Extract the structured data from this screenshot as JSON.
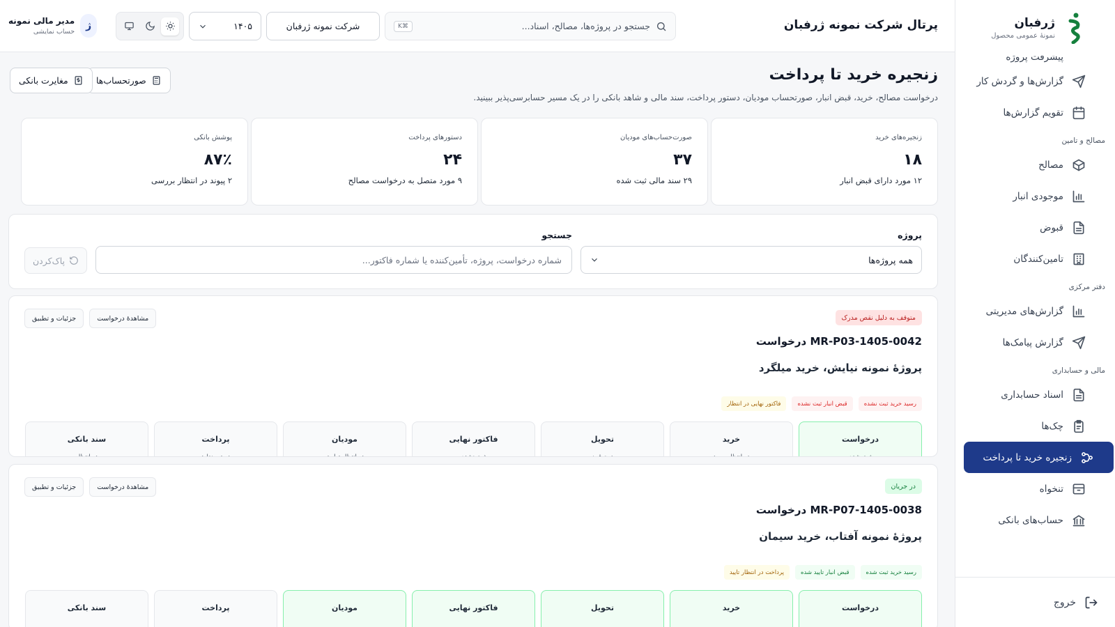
{
  "brand": {
    "name": "ژرفبان",
    "subtitle": "نمونهٔ عمومی محصول",
    "color": "#15803d"
  },
  "sidebar": {
    "partial_item": "پیشرفت پروژه",
    "top_items": [
      {
        "label": "گزارش‌ها و گردش کار",
        "icon": "send-icon"
      },
      {
        "label": "تقویم گزارش‌ها",
        "icon": "calendar-icon"
      }
    ],
    "sections": [
      {
        "title": "مصالح و تامین",
        "items": [
          {
            "label": "مصالح",
            "icon": "box-icon"
          },
          {
            "label": "موجودی انبار",
            "icon": "bar-chart-icon"
          },
          {
            "label": "قبوض",
            "icon": "document-icon"
          },
          {
            "label": "تامین‌کنندگان",
            "icon": "building-icon"
          }
        ]
      },
      {
        "title": "دفتر مرکزی",
        "items": [
          {
            "label": "گزارش‌های مدیریتی",
            "icon": "bar-chart-icon"
          },
          {
            "label": "گزارش پیامک‌ها",
            "icon": "send-icon"
          }
        ]
      },
      {
        "title": "مالی و حسابداری",
        "items": [
          {
            "label": "اسناد حسابداری",
            "icon": "document-icon"
          },
          {
            "label": "چک‌ها",
            "icon": "clipboard-icon"
          },
          {
            "label": "زنجیره خرید تا پرداخت",
            "icon": "workflow-icon",
            "active": true
          },
          {
            "label": "تنخواه",
            "icon": "archive-icon"
          },
          {
            "label": "حساب‌های بانکی",
            "icon": "bank-icon"
          }
        ]
      }
    ],
    "logout": "خروج",
    "active_color": "#1e3a8a"
  },
  "header": {
    "title": "پرتال شرکت نمونه ژرفبان",
    "search_placeholder": "جستجو در پروژه‌ها، مصالح، اسناد...",
    "search_shortcut": "K⌘",
    "company": "شرکت نمونه ژرفبان",
    "year": "۱۴۰۵",
    "theme_modes": [
      "light-icon",
      "dark-icon",
      "system-icon"
    ],
    "theme_selected": "light",
    "user": {
      "initial": "ژ",
      "name": "مدیر مالی نمونه",
      "role": "حساب نمایشی"
    }
  },
  "page": {
    "title": "زنجیره خرید تا پرداخت",
    "description": "درخواست مصالح، خرید، قبض انبار، صورتحساب مودیان، دستور پرداخت، سند مالی و شاهد بانکی را در یک مسیر حسابرسی‌پذیر ببینید.",
    "buttons": {
      "invoices": "صورتحساب‌ها",
      "bank_reconcile": "مغایرت بانکی"
    }
  },
  "stats": [
    {
      "label": "زنجیره‌های خرید",
      "value": "۱۸",
      "sub": "۱۲ مورد دارای قبض انبار"
    },
    {
      "label": "صورت‌حساب‌های مودیان",
      "value": "۳۷",
      "sub": "۲۹ سند مالی ثبت شده"
    },
    {
      "label": "دستورهای پرداخت",
      "value": "۲۴",
      "sub": "۹ مورد متصل به درخواست مصالح"
    },
    {
      "label": "پوشش بانکی",
      "value": "۸۷٪",
      "sub": "۲ پیوند در انتظار بررسی"
    }
  ],
  "filters": {
    "project_label": "پروژه",
    "project_value": "همه پروژه‌ها",
    "search_label": "جستجو",
    "search_placeholder": "شماره درخواست، پروژه، تأمین‌کننده یا شماره فاکتور...",
    "reset": "پاک‌کردن"
  },
  "requests": [
    {
      "status": "متوقف به دلیل نقص مدرک",
      "status_tone": "red",
      "id": "درخواست MR-P03-1405-0042",
      "project": "پروژهٔ نمونه نیایش، خرید میلگرد",
      "actions": [
        "مشاهدهٔ درخواست",
        "جزئیات و تطبیق"
      ],
      "tags": [
        {
          "text": "رسید خرید ثبت نشده",
          "tone": "red"
        },
        {
          "text": "قبض انبار ثبت نشده",
          "tone": "red"
        },
        {
          "text": "فاکتور نهایی در انتظار",
          "tone": "amber"
        }
      ],
      "steps": [
        {
          "name": "درخواست",
          "status": "ثبت شده",
          "done": true
        },
        {
          "name": "خرید",
          "status": "در انتظار رسید",
          "done": false
        },
        {
          "name": "تحویل",
          "status": "بدون قبض",
          "done": false
        },
        {
          "name": "فاکتور نهایی",
          "status": "ثبت نشده",
          "done": false
        },
        {
          "name": "مودیان",
          "status": "در انتظار تطبیق",
          "done": false
        },
        {
          "name": "پرداخت",
          "status": "دستور ندارد",
          "done": false
        },
        {
          "name": "سند بانکی",
          "status": "در انتظار",
          "done": false
        }
      ]
    },
    {
      "status": "در جریان",
      "status_tone": "green",
      "id": "درخواست MR-P07-1405-0038",
      "project": "پروژهٔ نمونه آفتاب، خرید سیمان",
      "actions": [
        "مشاهدهٔ درخواست",
        "جزئیات و تطبیق"
      ],
      "tags": [
        {
          "text": "رسید خرید ثبت شده",
          "tone": "green"
        },
        {
          "text": "قبض انبار تایید شده",
          "tone": "green"
        },
        {
          "text": "پرداخت در انتظار تایید",
          "tone": "amber"
        }
      ],
      "steps": [
        {
          "name": "درخواست",
          "status": "",
          "done": true
        },
        {
          "name": "خرید",
          "status": "",
          "done": true
        },
        {
          "name": "تحویل",
          "status": "",
          "done": true
        },
        {
          "name": "فاکتور نهایی",
          "status": "",
          "done": true
        },
        {
          "name": "مودیان",
          "status": "",
          "done": true
        },
        {
          "name": "پرداخت",
          "status": "",
          "done": false
        },
        {
          "name": "سند بانکی",
          "status": "",
          "done": false
        }
      ]
    }
  ]
}
